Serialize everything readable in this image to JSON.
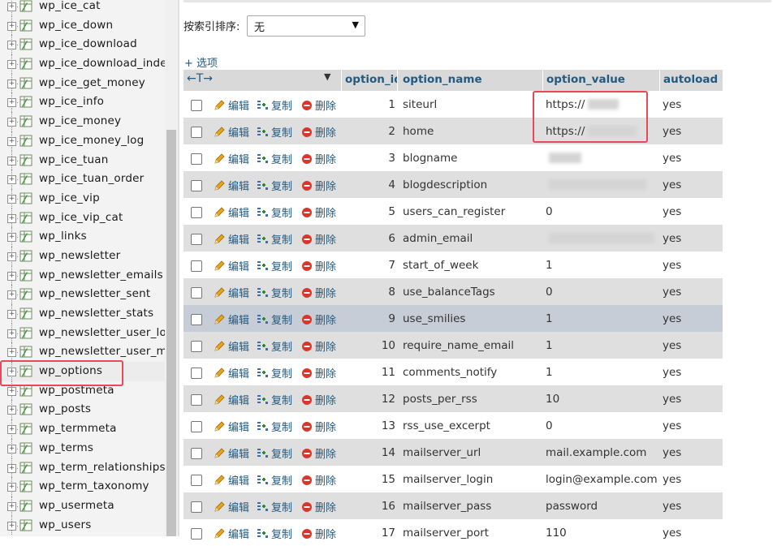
{
  "sidebar": {
    "tables": [
      "wp_ice_cat",
      "wp_ice_down",
      "wp_ice_download",
      "wp_ice_download_index",
      "wp_ice_get_money",
      "wp_ice_info",
      "wp_ice_money",
      "wp_ice_money_log",
      "wp_ice_tuan",
      "wp_ice_tuan_order",
      "wp_ice_vip",
      "wp_ice_vip_cat",
      "wp_links",
      "wp_newsletter",
      "wp_newsletter_emails",
      "wp_newsletter_sent",
      "wp_newsletter_stats",
      "wp_newsletter_user_logs",
      "wp_newsletter_user_meta",
      "wp_options",
      "wp_postmeta",
      "wp_posts",
      "wp_termmeta",
      "wp_terms",
      "wp_term_relationships",
      "wp_term_taxonomy",
      "wp_usermeta",
      "wp_users"
    ],
    "selected": "wp_options",
    "expander_symbol": "+"
  },
  "sort": {
    "label": "按索引排序:",
    "value": "无"
  },
  "options_link": "+ 选项",
  "columns": {
    "arrows": "←T→",
    "option_id": "option_id",
    "option_name": "option_name",
    "option_value": "option_value",
    "autoload": "autoload"
  },
  "actions": {
    "edit": "编辑",
    "copy": "复制",
    "delete": "删除"
  },
  "rows": [
    {
      "id": "1",
      "name": "siteurl",
      "value": "https://",
      "autoload": "yes"
    },
    {
      "id": "2",
      "name": "home",
      "value": "https://",
      "autoload": "yes"
    },
    {
      "id": "3",
      "name": "blogname",
      "value": "",
      "autoload": "yes"
    },
    {
      "id": "4",
      "name": "blogdescription",
      "value": "",
      "autoload": "yes"
    },
    {
      "id": "5",
      "name": "users_can_register",
      "value": "0",
      "autoload": "yes"
    },
    {
      "id": "6",
      "name": "admin_email",
      "value": "",
      "autoload": "yes"
    },
    {
      "id": "7",
      "name": "start_of_week",
      "value": "1",
      "autoload": "yes"
    },
    {
      "id": "8",
      "name": "use_balanceTags",
      "value": "0",
      "autoload": "yes"
    },
    {
      "id": "9",
      "name": "use_smilies",
      "value": "1",
      "autoload": "yes"
    },
    {
      "id": "10",
      "name": "require_name_email",
      "value": "1",
      "autoload": "yes"
    },
    {
      "id": "11",
      "name": "comments_notify",
      "value": "1",
      "autoload": "yes"
    },
    {
      "id": "12",
      "name": "posts_per_rss",
      "value": "10",
      "autoload": "yes"
    },
    {
      "id": "13",
      "name": "rss_use_excerpt",
      "value": "0",
      "autoload": "yes"
    },
    {
      "id": "14",
      "name": "mailserver_url",
      "value": "mail.example.com",
      "autoload": "yes"
    },
    {
      "id": "15",
      "name": "mailserver_login",
      "value": "login@example.com",
      "autoload": "yes"
    },
    {
      "id": "16",
      "name": "mailserver_pass",
      "value": "password",
      "autoload": "yes"
    },
    {
      "id": "17",
      "name": "mailserver_port",
      "value": "110",
      "autoload": "yes"
    }
  ],
  "hover_row_id": "9",
  "colors": {
    "link": "#235a81",
    "highlight": "#e8485a",
    "hover_row": "#c6cdd6"
  }
}
